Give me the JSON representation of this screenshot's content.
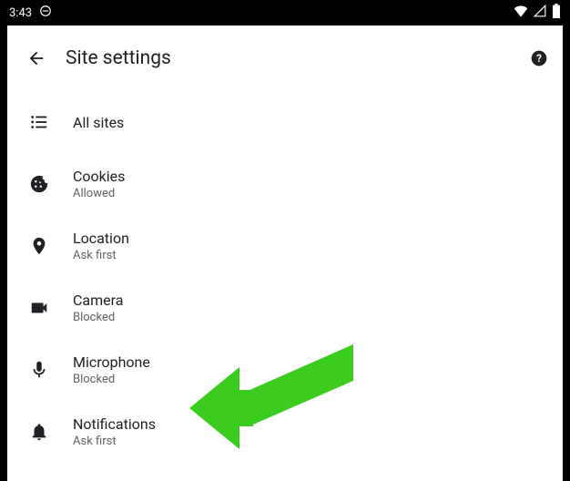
{
  "statusbar": {
    "time": "3:43"
  },
  "header": {
    "title": "Site settings"
  },
  "items": [
    {
      "label": "All sites",
      "sub": ""
    },
    {
      "label": "Cookies",
      "sub": "Allowed"
    },
    {
      "label": "Location",
      "sub": "Ask first"
    },
    {
      "label": "Camera",
      "sub": "Blocked"
    },
    {
      "label": "Microphone",
      "sub": "Blocked"
    },
    {
      "label": "Notifications",
      "sub": "Ask first"
    }
  ]
}
